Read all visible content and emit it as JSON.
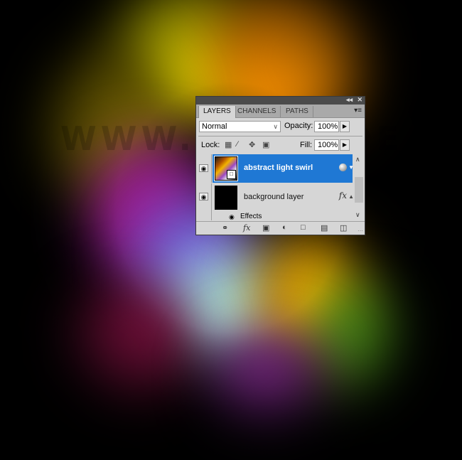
{
  "background": {
    "watermark": "WWW.PSDDUDE.COM"
  },
  "panel": {
    "collapse_icon": "◂◂",
    "close_icon": "✕",
    "tabs": [
      {
        "label": "LAYERS",
        "active": true
      },
      {
        "label": "CHANNELS",
        "active": false
      },
      {
        "label": "PATHS",
        "active": false
      }
    ],
    "menu_icon": "▾≡",
    "blend_mode": "Normal",
    "opacity_label": "Opacity:",
    "opacity_value": "100%",
    "lock_label": "Lock:",
    "fill_label": "Fill:",
    "fill_value": "100%",
    "layers": [
      {
        "name": "abstract light swirl",
        "selected": true,
        "badge": "smart-filter"
      },
      {
        "name": "background layer",
        "selected": false,
        "badge": "fx"
      }
    ],
    "effects_label": "Effects",
    "fx_label": "fx"
  }
}
